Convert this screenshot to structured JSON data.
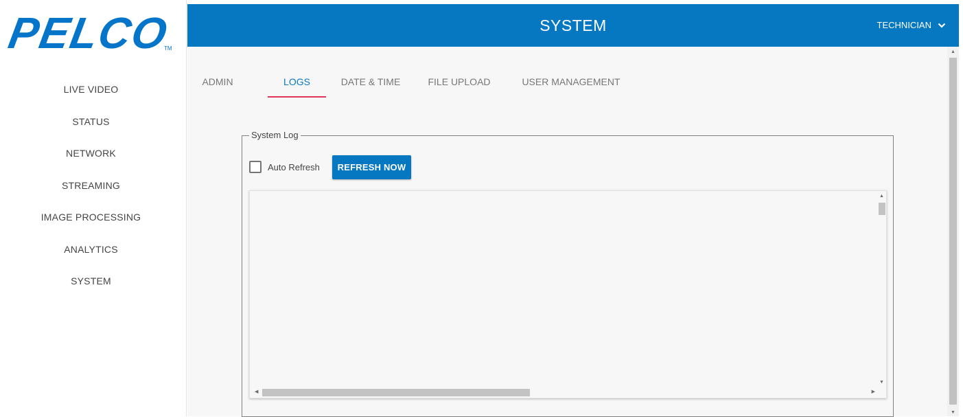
{
  "brand": {
    "name": "PELCO",
    "trademark": "TM",
    "color": "#0575c9"
  },
  "sidebar": {
    "items": [
      {
        "label": "LIVE VIDEO"
      },
      {
        "label": "STATUS"
      },
      {
        "label": "NETWORK"
      },
      {
        "label": "STREAMING"
      },
      {
        "label": "IMAGE PROCESSING"
      },
      {
        "label": "ANALYTICS"
      },
      {
        "label": "SYSTEM"
      }
    ]
  },
  "header": {
    "title": "SYSTEM",
    "user": "TECHNICIAN",
    "user_icon": "chevron-down-icon",
    "background": "#0578c1"
  },
  "tabs": [
    {
      "label": "ADMIN"
    },
    {
      "label": "LOGS",
      "active": true
    },
    {
      "label": "DATE & TIME"
    },
    {
      "label": "FILE UPLOAD"
    },
    {
      "label": "USER MANAGEMENT"
    }
  ],
  "active_tab_indicator_color": "#e2345b",
  "system_log": {
    "legend": "System Log",
    "auto_refresh_label": "Auto Refresh",
    "auto_refresh_checked": false,
    "refresh_button_label": "REFRESH NOW",
    "log_text": ""
  }
}
